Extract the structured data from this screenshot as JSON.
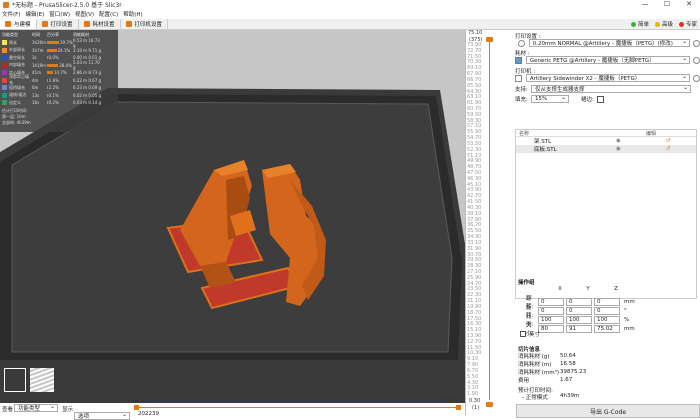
{
  "window": {
    "title": "*无标题 - PrusaSlicer-2.5.0 基于 Slic3r",
    "min": "—",
    "max": "☐",
    "close": "✕"
  },
  "menu": [
    "文件(F)",
    "编辑(E)",
    "窗口(W)",
    "视图(V)",
    "配置(C)",
    "帮助(H)"
  ],
  "tabs": [
    "与建模",
    "打印设置",
    "耗材设置",
    "打印机设置"
  ],
  "modes": [
    {
      "label": "简单",
      "color": "#3bb33b"
    },
    {
      "label": "高级",
      "color": "#e6b800"
    },
    {
      "label": "专家",
      "color": "#d9322c"
    }
  ],
  "legend": {
    "headers": [
      "功能类型",
      "时间",
      "百分率",
      "消耗耗材"
    ],
    "rows": [
      {
        "name": "周长",
        "time": "1h20m",
        "pct": "29.7%",
        "fil": "6.53 m  16.73 g",
        "color": "#f7e34b",
        "bar": 0.3
      },
      {
        "name": "外部周长",
        "time": "1h7m",
        "pct": "24.1%",
        "fil": "3.19 m  9.71 g",
        "color": "#f08b26",
        "bar": 0.24
      },
      {
        "name": "悬空周长",
        "time": "3s",
        "pct": "0.0%",
        "fil": "0.00 m  0.01 g",
        "color": "#2f4fbf",
        "bar": 0.0
      },
      {
        "name": "内部填充",
        "time": "1h19m",
        "pct": "28.4%",
        "fil": "5.63 m  11.70 g",
        "color": "#b02a2a",
        "bar": 0.28
      },
      {
        "name": "实心填充",
        "time": "41m",
        "pct": "14.7%",
        "fil": "2.86 m  8.73 g",
        "color": "#9a35b5",
        "bar": 0.15
      },
      {
        "name": "顶部实心填充",
        "time": "4m",
        "pct": "1.6%",
        "fil": "0.22 m  0.67 g",
        "color": "#e8443a",
        "bar": 0.02
      },
      {
        "name": "搭桥填充",
        "time": "6m",
        "pct": "2.2%",
        "fil": "0.23 m  0.69 g",
        "color": "#6e86d6",
        "bar": 0.02
      },
      {
        "name": "裙线/裙边",
        "time": "13s",
        "pct": "0.1%",
        "fil": "0.02 m  0.05 g",
        "color": "#1a9b86",
        "bar": 0.0
      },
      {
        "name": "自定义",
        "time": "16s",
        "pct": "0.2%",
        "fil": "0.03 m  0.14 g",
        "color": "#3a9c5e",
        "bar": 0.0
      }
    ],
    "footer1": "估计打印时间:",
    "footer2": "第一层: 10m",
    "footer3": "全部的: 4h39m"
  },
  "ruler": {
    "top": "75.10",
    "top2": "(375)",
    "ticks": [
      "73.90",
      "72.70",
      "71.50",
      "70.30",
      "69.10",
      "67.90",
      "66.70",
      "65.50",
      "64.30",
      "63.10",
      "61.90",
      "60.70",
      "59.50",
      "58.30",
      "57.10",
      "55.90",
      "54.70",
      "53.50",
      "52.30",
      "51.10",
      "49.90",
      "48.70",
      "47.50",
      "46.30",
      "45.10",
      "43.90",
      "42.70",
      "41.50",
      "40.30",
      "39.10",
      "37.90",
      "36.70",
      "35.50",
      "34.30",
      "33.10",
      "31.90",
      "30.70",
      "29.50",
      "28.30",
      "27.10",
      "25.90",
      "24.70",
      "23.50",
      "22.30",
      "21.10",
      "19.90",
      "18.70",
      "17.50",
      "16.30",
      "15.10",
      "13.90",
      "12.70",
      "11.50",
      "10.30",
      "9.10",
      "7.90",
      "6.70",
      "5.50",
      "4.30",
      "3.10",
      "1.90"
    ],
    "bottom": "0.30",
    "bottom2": "(1)"
  },
  "panel": {
    "print_settings_label": "打印设置 :",
    "print_profile": "0.20mm NORMAL @Artillery - 魔捷板（PETG）(修改)",
    "filament_label": "耗材 :",
    "filament_profile": "Generic PETG @Artillery - 魔捷板（无脚PETG）",
    "printer_label": "打印机 :",
    "printer_profile": "Artillery Sidewinder X2 - 魔捷板（PETG）",
    "support_label": "支持:",
    "support_value": "仅从支撑生成器支撑",
    "infill_label": "填充:",
    "infill_value": "15%",
    "brim_label": "裙边:",
    "obj_headers": [
      "名称",
      "编辑"
    ],
    "objects": [
      "架.STL",
      "底板.STL"
    ],
    "manip_title": "操作组",
    "axes": [
      "X",
      "Y",
      "Z"
    ],
    "position_label": "翻转:",
    "position_values": [
      "0",
      "0",
      "0"
    ],
    "position_unit": "mm",
    "rotation_label": "旋转:",
    "rotation_values": [
      "0",
      "0",
      "0"
    ],
    "rotation_unit": "°",
    "scale_label": "比例:",
    "scale_values": [
      "100",
      "100",
      "100"
    ],
    "scale_unit": "%",
    "size_label": "大小:",
    "size_values": [
      "80",
      "91",
      "75.02"
    ],
    "size_unit": "mm",
    "inches_label": "英寸",
    "slice_title": "切片信息",
    "slice_info": [
      {
        "k": "消耗耗材 (g)",
        "v": "50.64"
      },
      {
        "k": "消耗耗材 (m)",
        "v": "16.58"
      },
      {
        "k": "消耗耗材 (mm³)",
        "v": "39875.23"
      },
      {
        "k": "费用",
        "v": "1.67"
      }
    ],
    "est_label": "预计打印时间:",
    "mode_label": "- 正常模式",
    "mode_time": "4h39m"
  },
  "gcode_button": "导出 G-Code",
  "bottom": {
    "view_label": "查看",
    "view_value": "功能类型",
    "show_label": "显示",
    "show_value": "选项",
    "slider_left": "202239",
    "slider_right": "202265"
  }
}
